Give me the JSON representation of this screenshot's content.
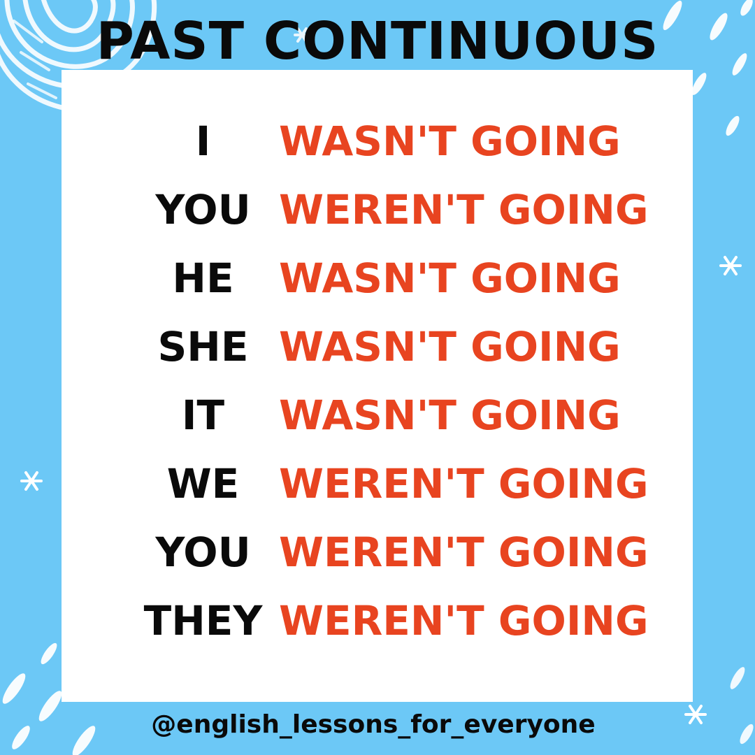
{
  "title": "PAST CONTINUOUS",
  "rows": [
    {
      "pronoun": "I",
      "verb": "WASN'T GOING"
    },
    {
      "pronoun": "YOU",
      "verb": "WEREN'T GOING"
    },
    {
      "pronoun": "HE",
      "verb": "WASN'T GOING"
    },
    {
      "pronoun": "SHE",
      "verb": "WASN'T GOING"
    },
    {
      "pronoun": "IT",
      "verb": "WASN'T GOING"
    },
    {
      "pronoun": "WE",
      "verb": "WEREN'T GOING"
    },
    {
      "pronoun": "YOU",
      "verb": "WEREN'T GOING"
    },
    {
      "pronoun": "THEY",
      "verb": "WEREN'T GOING"
    }
  ],
  "footer": "@english_lessons_for_everyone",
  "colors": {
    "background": "#6cc8f6",
    "card": "#ffffff",
    "pronoun_text": "#0a0a0a",
    "verb_text": "#e84420",
    "decoration": "#ffffff"
  },
  "decorations": [
    "swirl-doodle",
    "dash-doodle",
    "asterisk-doodle"
  ]
}
